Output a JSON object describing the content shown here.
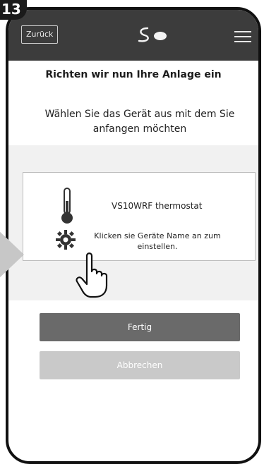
{
  "step": "13",
  "header": {
    "back_label": "Zurück"
  },
  "main": {
    "title": "Richten wir nun Ihre Anlage ein",
    "subtitle": "Wählen Sie das Gerät aus mit dem Sie anfangen möchten",
    "device": {
      "name": "VS10WRF thermostat",
      "hint": "Klicken sie Geräte Name an zum einstellen."
    },
    "buttons": {
      "done": "Fertig",
      "cancel": "Abbrechen"
    }
  },
  "colors": {
    "topbar": "#3c3c3c",
    "primary_button": "#6a6a6a",
    "secondary_button": "#c9c9c9",
    "panel_bg": "#f1f1f1"
  },
  "icons": [
    "thermometer-icon",
    "gear-icon",
    "pointing-hand-icon",
    "hamburger-menu-icon",
    "logo-icon",
    "arrow-icon"
  ]
}
